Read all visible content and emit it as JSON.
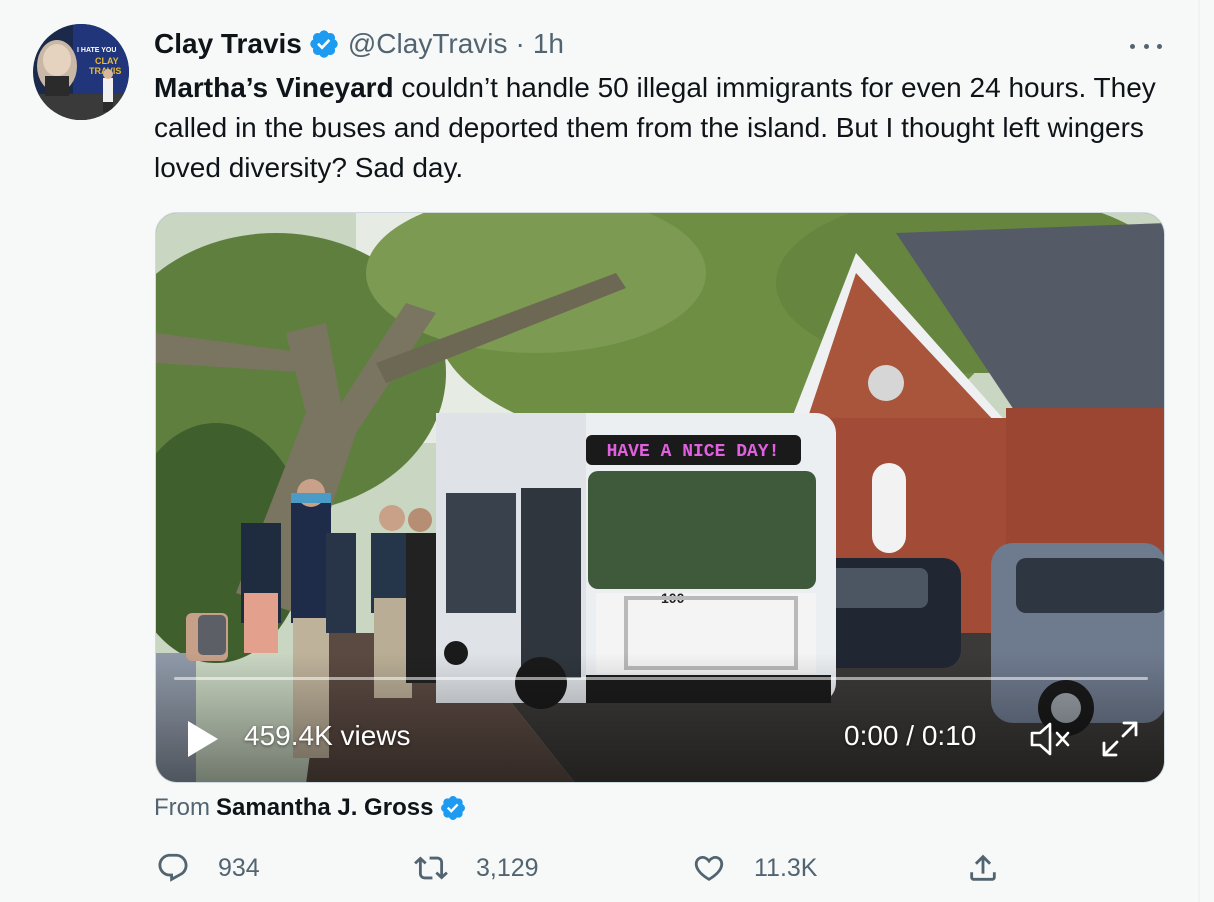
{
  "tweet": {
    "author": {
      "display_name": "Clay Travis",
      "handle": "@ClayTravis",
      "time": "1h"
    },
    "avatar_text": {
      "line1": "I HATE YOU",
      "line2": "CLAY",
      "line3": "TRAVIS"
    },
    "text": {
      "bold_lead": "Martha’s Vineyard",
      "rest": " couldn’t handle 50 illegal immigrants for even 24 hours. They called in the buses and deported them from the island. But I thought left wingers loved diversity? Sad day."
    },
    "media": {
      "views": "459.4K views",
      "time_display": "0:00 / 0:10",
      "progress": 0,
      "bus_sign": "HAVE A NICE DAY!",
      "bus_number": "100"
    },
    "attribution": {
      "prefix": "From",
      "name": "Samantha J. Gross"
    },
    "actions": {
      "replies": "934",
      "retweets": "3,129",
      "likes": "11.3K"
    }
  },
  "colors": {
    "text_primary": "#0f1419",
    "text_secondary": "#536471",
    "verified_blue": "#1d9bf0",
    "background": "#f7f9f9"
  },
  "icons": [
    "verified-badge-icon",
    "more-icon",
    "play-icon",
    "mute-icon",
    "fullscreen-icon",
    "reply-icon",
    "retweet-icon",
    "like-icon",
    "share-icon"
  ]
}
